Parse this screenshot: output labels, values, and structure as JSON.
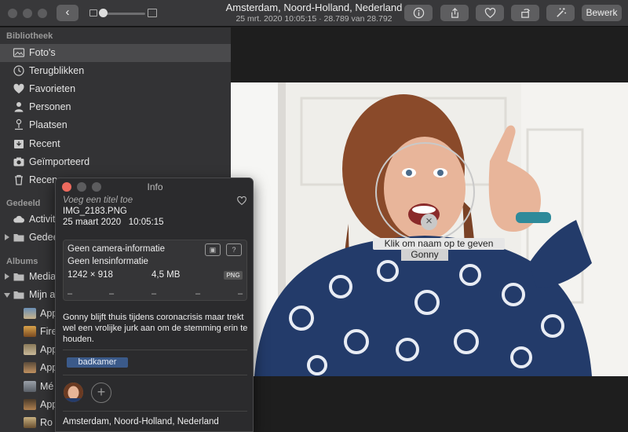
{
  "window": {
    "title": "Amsterdam, Noord-Holland, Nederland",
    "subtitle": "25 mrt. 2020 10:05:15  ·  28.789 van 28.792",
    "edit_label": "Bewerk",
    "back_glyph": "‹"
  },
  "toolbar_icons": [
    "back-icon",
    "info-icon",
    "share-icon",
    "heart-icon",
    "rotate-icon",
    "magic-wand-icon"
  ],
  "sidebar": {
    "library_header": "Bibliotheek",
    "library_items": [
      {
        "label": "Foto's",
        "icon": "photos-icon",
        "selected": true
      },
      {
        "label": "Terugblikken",
        "icon": "memories-icon"
      },
      {
        "label": "Favorieten",
        "icon": "heart-icon"
      },
      {
        "label": "Personen",
        "icon": "person-icon"
      },
      {
        "label": "Plaatsen",
        "icon": "pin-icon"
      },
      {
        "label": "Recent",
        "icon": "import-tray-icon"
      },
      {
        "label": "Geïmporteerd",
        "icon": "camera-icon"
      },
      {
        "label": "Recen",
        "icon": "trash-icon"
      }
    ],
    "shared_header": "Gedeeld",
    "shared_items": [
      {
        "label": "Activit",
        "icon": "cloud-icon"
      },
      {
        "label": "Gedee",
        "icon": "folder-icon"
      }
    ],
    "albums_header": "Albums",
    "album_items": [
      {
        "label": "Media",
        "icon": "folder-icon"
      },
      {
        "label": "Mijn a",
        "icon": "folder-icon"
      },
      {
        "label": "App",
        "icon": "album-thumb"
      },
      {
        "label": "Fire",
        "icon": "album-thumb"
      },
      {
        "label": "App",
        "icon": "album-thumb"
      },
      {
        "label": "App",
        "icon": "album-thumb"
      },
      {
        "label": "Mé",
        "icon": "album-thumb"
      },
      {
        "label": "App",
        "icon": "album-thumb"
      },
      {
        "label": "Ro",
        "icon": "album-thumb"
      }
    ]
  },
  "face_tag": {
    "hint": "Klik om naam op te geven",
    "name": "Gonny",
    "close_glyph": "×"
  },
  "info_panel": {
    "title": "Info",
    "title_placeholder": "Voeg een titel toe",
    "filename": "IMG_2183.PNG",
    "date": "25 maart 2020",
    "time": "10:05:15",
    "camera": "Geen camera-informatie",
    "lens": "Geen lensinformatie",
    "dimensions": "1242 × 918",
    "filesize": "4,5 MB",
    "format": "PNG",
    "exif_dashes": [
      "–",
      "–",
      "–",
      "–",
      "–"
    ],
    "caption": "Gonny blijft thuis tijdens coronacrisis maar trekt wel een vrolijke jurk aan om de stemming erin te houden.",
    "keyword": "badkamer",
    "add_face_glyph": "+",
    "location": "Amsterdam, Noord-Holland, Nederland"
  },
  "colors": {
    "toolbar": "#38383a",
    "sidebar": "#333335",
    "panel": "#2b2b2d",
    "keyword": "#3b5a8a",
    "selection": "#4a4a4c"
  }
}
